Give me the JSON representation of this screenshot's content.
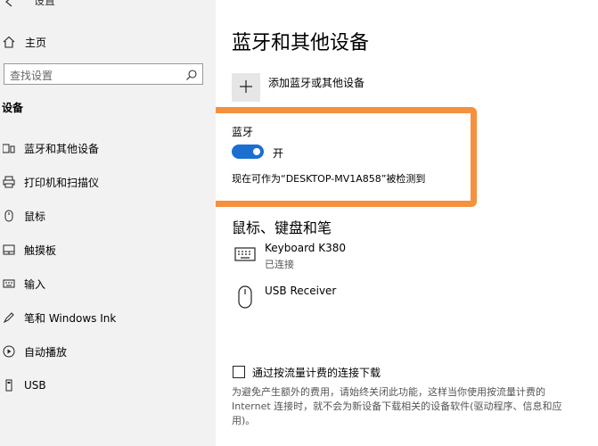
{
  "window": {
    "title": "设置"
  },
  "sidebar": {
    "home_label": "主页",
    "search_placeholder": "查找设置",
    "section_title": "设备",
    "items": [
      {
        "label": "蓝牙和其他设备",
        "icon": "devices-icon"
      },
      {
        "label": "打印机和扫描仪",
        "icon": "printer-icon"
      },
      {
        "label": "鼠标",
        "icon": "mouse-icon"
      },
      {
        "label": "触摸板",
        "icon": "touchpad-icon"
      },
      {
        "label": "输入",
        "icon": "keyboard-icon"
      },
      {
        "label": "笔和 Windows Ink",
        "icon": "pen-icon"
      },
      {
        "label": "自动播放",
        "icon": "autoplay-icon"
      },
      {
        "label": "USB",
        "icon": "usb-icon"
      }
    ]
  },
  "main": {
    "title": "蓝牙和其他设备",
    "add_device_label": "添加蓝牙或其他设备",
    "bluetooth": {
      "label": "蓝牙",
      "toggle_state": "开",
      "is_on": true,
      "discoverable_text": "现在可作为“DESKTOP-MV1A858”被检测到",
      "highlight_color": "#f5913e",
      "toggle_color": "#1a6fd1"
    },
    "section_title": "鼠标、键盘和笔",
    "devices": [
      {
        "name": "Keyboard K380",
        "status": "已连接",
        "icon": "keyboard-icon"
      },
      {
        "name": "USB Receiver",
        "status": "",
        "icon": "mouse-icon"
      }
    ],
    "metered": {
      "label": "通过按流量计费的连接下载",
      "checked": false,
      "note": "为避免产生额外的费用，请始终关闭此功能，这样当你使用按流量计费的 Internet 连接时，就不会为新设备下载相关的设备软件(驱动程序、信息和应用)。"
    }
  }
}
